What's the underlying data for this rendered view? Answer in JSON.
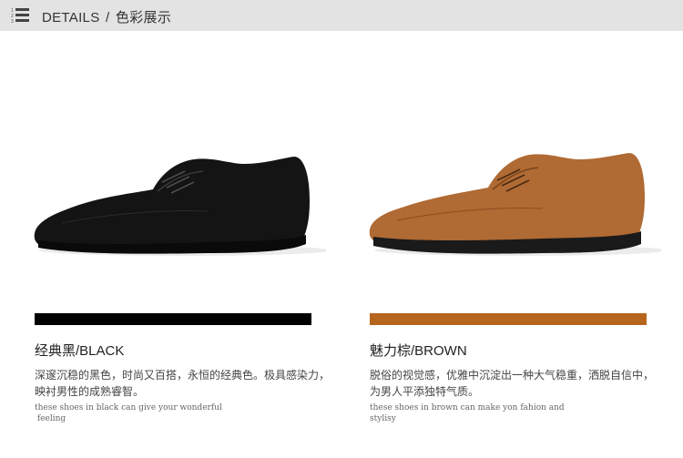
{
  "header": {
    "title": "DETAILS",
    "subtitle": "色彩展示",
    "icon": "numbered-list-icon",
    "background": "#e3e3e3"
  },
  "products": [
    {
      "color_name": "经典黑/BLACK",
      "swatch": "#000000",
      "shoe_color": "#141414",
      "cn_lines": [
        "深邃沉稳的黑色，时尚又百搭，永恒的经典色。极具感染力，",
        "映衬男性的成熟睿智。"
      ],
      "en_lines": [
        "these shoes in black can give your wonderful",
        " feeling"
      ]
    },
    {
      "color_name": "魅力棕/BROWN",
      "swatch": "#b5651c",
      "shoe_color": "#b06a33",
      "cn_lines": [
        "脱俗的视觉感，优雅中沉淀出一种大气稳重，洒脱自信中，",
        "为男人平添独特气质。"
      ],
      "en_lines": [
        "these shoes in brown can make yon fahion and",
        "stylisy"
      ]
    }
  ]
}
